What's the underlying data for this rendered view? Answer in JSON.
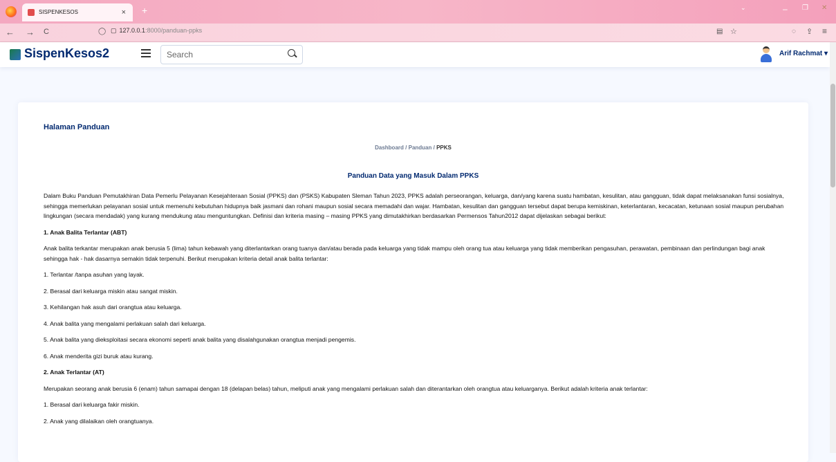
{
  "browser": {
    "tab_title": "SISPENKESOS",
    "tab_close": "×",
    "new_tab": "+",
    "url_host": "127.0.0.1",
    "url_path": ":8000/panduan-ppks",
    "back": "←",
    "forward": "→",
    "reload": "C",
    "minimize": "–",
    "restore": "❐",
    "close": "✕"
  },
  "app": {
    "brand": "SispenKesos2",
    "search_placeholder": "Search",
    "user_name": "Arif Rachmat ▾"
  },
  "page": {
    "title": "Halaman Panduan",
    "breadcrumb": {
      "dashboard": "Dashboard",
      "sep1": "/",
      "panduan": "Panduan",
      "sep2": "/",
      "current": "PPKS"
    },
    "heading": "Panduan Data yang Masuk Dalam PPKS",
    "intro": "Dalam Buku Panduan Pemutakhiran Data Pemerlu Pelayanan Kesejahteraan Sosial (PPKS) dan (PSKS) Kabupaten Sleman Tahun 2023, PPKS adalah perseorangan, keluarga, dan/yang karena suatu hambatan, kesulitan, atau gangguan, tidak dapat melaksanakan funsi sosialnya, sehingga memerlukan pelayanan sosial untuk memenuhi kebutuhan hidupnya baik jasmani dan rohani maupun sosial secara memadahi dan wajar. Hambatan, kesulitan dan gangguan tersebut dapat berupa kemiskinan, keterlantaran, kecacatan, ketunaan sosial maupun perubahan lingkungan (secara mendadak) yang kurang mendukung atau menguntungkan. Definisi dan kriteria masing – masing PPKS yang dimutakhirkan berdasarkan Permensos Tahun2012 dapat dijelaskan sebagai berikut:",
    "sections": [
      {
        "title": "1. Anak Balita Terlantar (ABT)",
        "desc": "Anak balita terkantar merupakan anak berusia 5 (lima) tahun kebawah yang diterlantarkan orang tuanya dan/atau berada pada keluarga yang tidak mampu oleh orang tua atau keluarga yang tidak memberikan pengasuhan, perawatan, pembinaan dan perlindungan bagi anak sehingga hak - hak dasarnya semakin tidak terpenuhi. Berikut merupakan kriteria detail anak balita terlantar:",
        "items": [
          "1. Terlantar /tanpa asuhan yang layak.",
          "2. Berasal dari keluarga miskin atau sangat miskin.",
          "3. Kehilangan hak asuh dari orangtua atau keluarga.",
          "4. Anak balita yang mengalami perlakuan salah dari keluarga.",
          "5. Anak balita yang dieksploitasi secara ekonomi seperti anak balita yang disalahgunakan orangtua menjadi pengemis.",
          "6. Anak menderita gizi buruk atau kurang."
        ]
      },
      {
        "title": "2. Anak Terlantar (AT)",
        "desc": "Merupakan seorang anak berusia 6 (enam) tahun samapai dengan 18 (delapan belas) tahun, meliputi anak yang mengalami perlakuan salah dan diterantarkan oleh orangtua atau keluarganya. Berikut adalah kriteria anak terlantar:",
        "items": [
          "1. Berasal dari keluarga fakir miskin.",
          "2. Anak yang dilalaikan oleh orangtuanya."
        ]
      }
    ]
  }
}
